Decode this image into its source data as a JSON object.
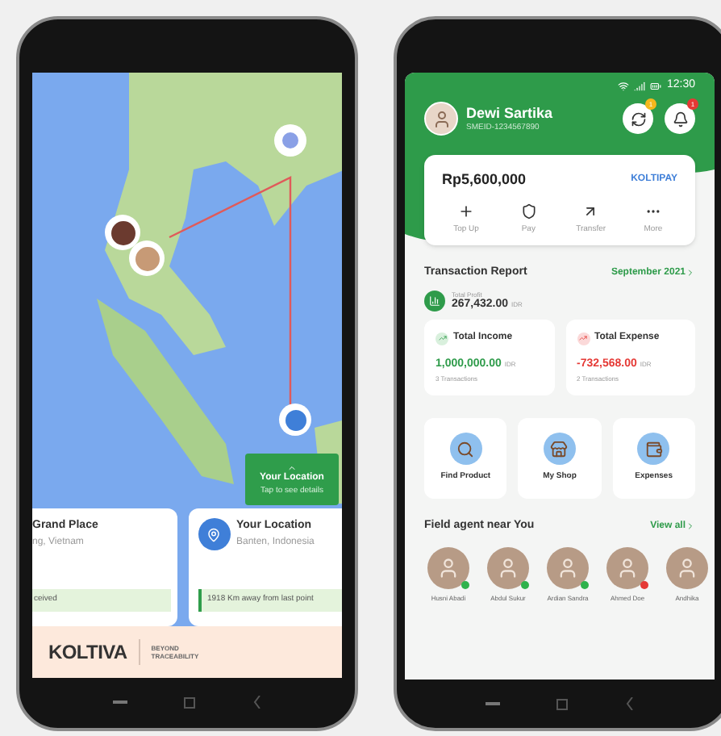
{
  "map_phone": {
    "map_callout": {
      "title": "Your Location",
      "subtitle": "Tap to see details"
    },
    "cards": [
      {
        "title": "Grand Place",
        "subtitle": "ng, Vietnam",
        "note": "ceived",
        "kind": "partial"
      },
      {
        "title": "Your Location",
        "subtitle": "Banten, Indonesia",
        "note": "1918 Km away from last point",
        "kind": "location"
      }
    ],
    "banner": {
      "logo": "KOLTIVA",
      "tagline_1": "BEYOND",
      "tagline_2": "TRACEABILITY"
    }
  },
  "wallet_phone": {
    "status_bar": {
      "time": "12:30"
    },
    "user": {
      "name": "Dewi Sartika",
      "id": "SMEID-1234567890"
    },
    "sync_badge": "1",
    "notification_badge": "1",
    "balance": {
      "amount": "Rp5,600,000",
      "logo": "KOLTIPAY"
    },
    "actions": [
      {
        "label": "Top Up",
        "kind": "plus"
      },
      {
        "label": "Pay",
        "kind": "shield"
      },
      {
        "label": "Transfer",
        "kind": "arrow"
      },
      {
        "label": "More",
        "kind": "more"
      }
    ],
    "report": {
      "title": "Transaction Report",
      "period": "September 2021",
      "profit_label": "Total Profit",
      "profit": "267,432.00",
      "profit_unit": "IDR",
      "totals": [
        {
          "label": "Total Income",
          "amount": "1,000,000.00",
          "unit": "IDR",
          "count": "3 Transactions",
          "kind": "income"
        },
        {
          "label": "Total Expense",
          "amount": "-732,568.00",
          "unit": "IDR",
          "count": "2 Transactions",
          "kind": "expense"
        }
      ]
    },
    "menu": [
      {
        "label": "Find Product",
        "kind": "find"
      },
      {
        "label": "My Shop",
        "kind": "shop"
      },
      {
        "label": "Expenses",
        "kind": "wallet"
      }
    ],
    "agents_title": "Field agent near You",
    "view_all": "View all",
    "agents": [
      {
        "name": "Husni Abadi",
        "color": "#2fb24c"
      },
      {
        "name": "Abdul Sukur",
        "color": "#2fb24c"
      },
      {
        "name": "Ardian Sandra",
        "color": "#2fb24c"
      },
      {
        "name": "Ahmed Doe",
        "color": "#e53935"
      },
      {
        "name": "Andhika"
      }
    ]
  }
}
